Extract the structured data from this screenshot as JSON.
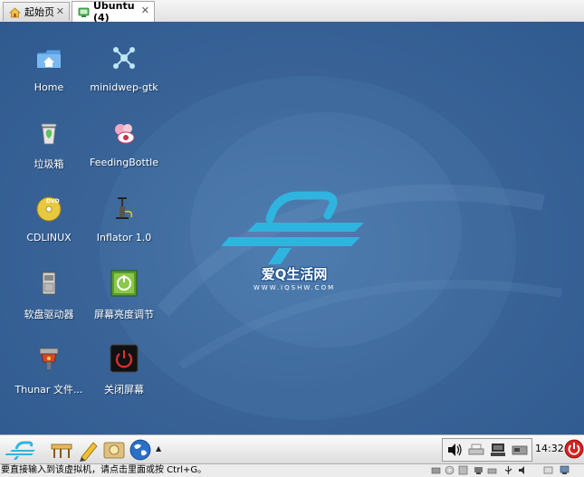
{
  "tabs": [
    {
      "label": "起始页",
      "active": false
    },
    {
      "label": "Ubuntu (4)",
      "active": true
    }
  ],
  "desktop": {
    "icons": [
      {
        "label": "Home",
        "icon": "home-folder-icon"
      },
      {
        "label": "minidwep-gtk",
        "icon": "minidwep-icon"
      },
      {
        "label": "垃圾箱",
        "icon": "trash-icon"
      },
      {
        "label": "FeedingBottle",
        "icon": "feedingbottle-icon"
      },
      {
        "label": "CDLINUX",
        "icon": "dvd-icon"
      },
      {
        "label": "Inflator 1.0",
        "icon": "inflator-pump-icon"
      },
      {
        "label": "软盘驱动器",
        "icon": "floppy-drive-icon"
      },
      {
        "label": "屏幕亮度调节",
        "icon": "brightness-icon"
      },
      {
        "label": "Thunar 文件...",
        "icon": "thunar-icon"
      },
      {
        "label": "关闭屏幕",
        "icon": "screen-off-icon"
      }
    ],
    "watermark": {
      "brand": "爱Q生活网",
      "url": "WWW.IQSHW.COM"
    }
  },
  "taskbar": {
    "items": [
      "start-menu-icon",
      "desktop-icon",
      "editor-icon",
      "file-manager-icon",
      "browser-icon"
    ],
    "tray": [
      "volume-icon",
      "printer-icon",
      "network-icon",
      "device-icon"
    ],
    "clock": "14:32",
    "power": "power-icon"
  },
  "statusbar": {
    "text": "要直接输入到该虚拟机，请点击里面或按 Ctrl+G。"
  },
  "colors": {
    "desktop": "#3b6599",
    "accent_cyan": "#2fb4df",
    "power": "#d92020"
  }
}
